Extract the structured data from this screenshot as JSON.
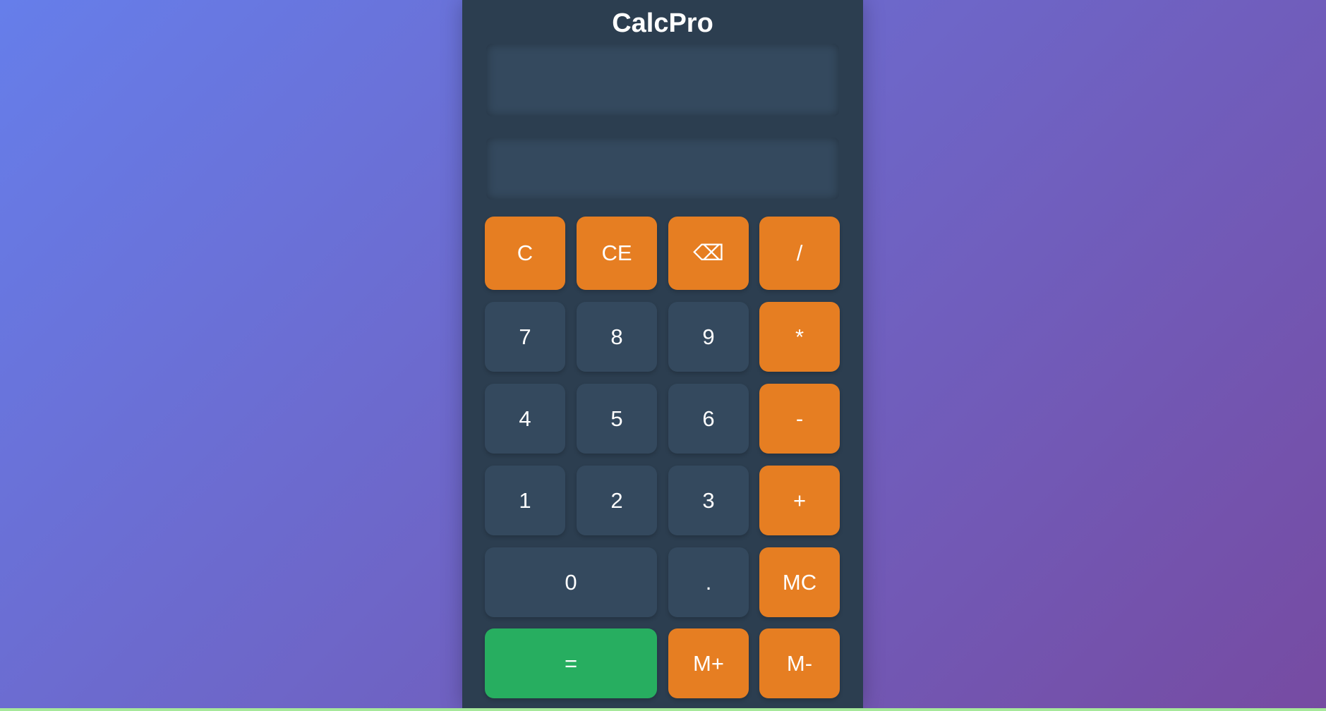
{
  "app": {
    "title": "CalcPro"
  },
  "display": {
    "expression": "",
    "result": ""
  },
  "keys": {
    "clear": "C",
    "clear_entry": "CE",
    "backspace": "⌫",
    "divide": "/",
    "seven": "7",
    "eight": "8",
    "nine": "9",
    "multiply": "*",
    "four": "4",
    "five": "5",
    "six": "6",
    "subtract": "-",
    "one": "1",
    "two": "2",
    "three": "3",
    "add": "+",
    "zero": "0",
    "decimal": ".",
    "memory_clear": "MC",
    "equals": "=",
    "memory_add": "M+",
    "memory_subtract": "M-"
  },
  "colors": {
    "background_start": "#667eea",
    "background_end": "#764ba2",
    "panel": "#2c3e50",
    "number_key": "#34495e",
    "operator_key": "#e67e22",
    "equals_key": "#27ae60"
  }
}
